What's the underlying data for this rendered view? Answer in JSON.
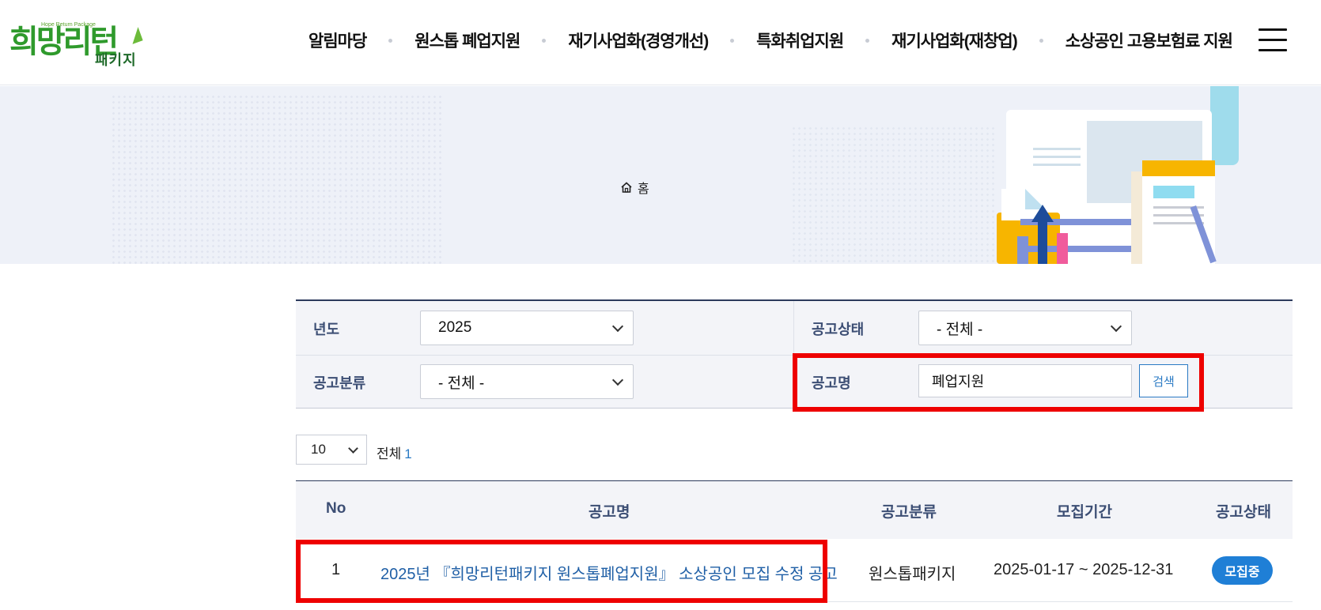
{
  "logo": {
    "main": "희망리턴",
    "sub": "패키지",
    "tagline": "Hope Return Package"
  },
  "nav": {
    "items": [
      {
        "label": "알림마당"
      },
      {
        "label": "원스톱 폐업지원"
      },
      {
        "label": "재기사업화(경영개선)"
      },
      {
        "label": "특화취업지원"
      },
      {
        "label": "재기사업화(재창업)"
      },
      {
        "label": "소상공인 고용보험료 지원"
      }
    ],
    "menu_icon": "hamburger-menu-icon"
  },
  "breadcrumb": {
    "home_icon": "home-icon",
    "label": "홈"
  },
  "filter": {
    "year": {
      "label": "년도",
      "value": "2025"
    },
    "status": {
      "label": "공고상태",
      "value": "- 전체 -"
    },
    "category": {
      "label": "공고분류",
      "value": "- 전체 -"
    },
    "title": {
      "label": "공고명",
      "value": "폐업지원"
    },
    "search_label": "검색"
  },
  "list": {
    "page_size": "10",
    "total_label": "전체",
    "total_count": "1"
  },
  "table": {
    "headers": {
      "no": "No",
      "title": "공고명",
      "category": "공고분류",
      "period": "모집기간",
      "status": "공고상태"
    },
    "rows": [
      {
        "no": "1",
        "title": "2025년 『희망리턴패키지 원스톱폐업지원』 소상공인 모집 수정 공고",
        "category": "원스톱패키지",
        "period": "2025-01-17 ~ 2025-12-31",
        "status": "모집중"
      }
    ]
  },
  "colors": {
    "accent_blue": "#1f7fd6",
    "highlight_red": "#ee0000",
    "label_navy": "#3c4e74",
    "logo_green": "#2f9a2c"
  }
}
